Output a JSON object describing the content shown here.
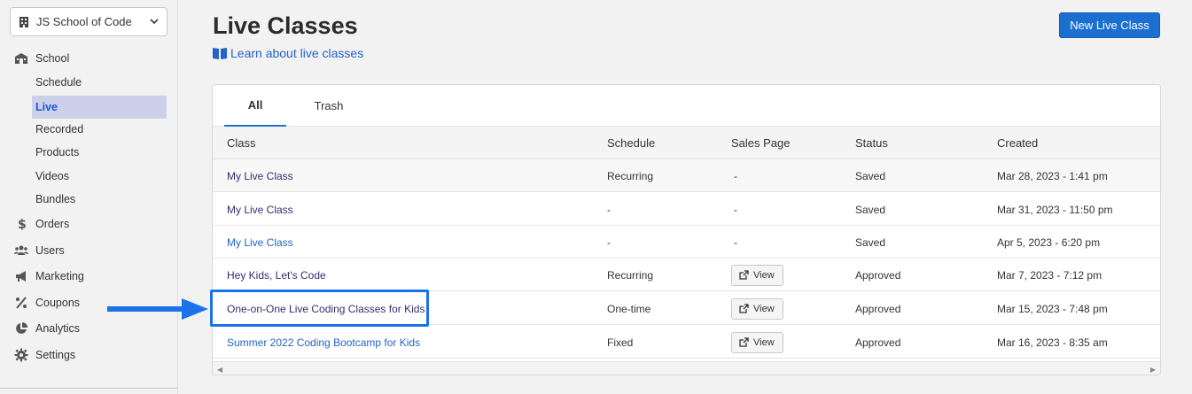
{
  "sidebar": {
    "school_name": "JS School of Code",
    "items": [
      {
        "label": "School",
        "icon": "school-icon"
      },
      {
        "label": "Orders",
        "icon": "dollar-icon"
      },
      {
        "label": "Users",
        "icon": "users-icon"
      },
      {
        "label": "Marketing",
        "icon": "megaphone-icon"
      },
      {
        "label": "Coupons",
        "icon": "percent-icon"
      },
      {
        "label": "Analytics",
        "icon": "pie-chart-icon"
      },
      {
        "label": "Settings",
        "icon": "gear-icon"
      }
    ],
    "sub_items": [
      "Schedule",
      "Live",
      "Recorded",
      "Products",
      "Videos",
      "Bundles"
    ],
    "active_sub_item": "Live"
  },
  "header": {
    "title": "Live Classes",
    "learn_link": "Learn about live classes",
    "new_button": "New Live Class"
  },
  "tabs": [
    "All",
    "Trash"
  ],
  "active_tab": "All",
  "table": {
    "columns": [
      "Class",
      "Schedule",
      "Sales Page",
      "Status",
      "Created"
    ],
    "rows": [
      {
        "class": "My Live Class",
        "schedule": "Recurring",
        "sales_page": "-",
        "status": "Saved",
        "created": "Mar 28, 2023 - 1:41 pm"
      },
      {
        "class": "My Live Class",
        "schedule": "-",
        "sales_page": "-",
        "status": "Saved",
        "created": "Mar 31, 2023 - 11:50 pm"
      },
      {
        "class": "My Live Class",
        "schedule": "-",
        "sales_page": "-",
        "status": "Saved",
        "created": "Apr 5, 2023 - 6:20 pm"
      },
      {
        "class": "Hey Kids, Let's Code",
        "schedule": "Recurring",
        "sales_page": "View",
        "status": "Approved",
        "created": "Mar 7, 2023 - 7:12 pm"
      },
      {
        "class": "One-on-One Live Coding Classes for Kids",
        "schedule": "One-time",
        "sales_page": "View",
        "status": "Approved",
        "created": "Mar 15, 2023 - 7:48 pm"
      },
      {
        "class": "Summer 2022 Coding Bootcamp for Kids",
        "schedule": "Fixed",
        "sales_page": "View",
        "status": "Approved",
        "created": "Mar 16, 2023 - 8:35 am"
      }
    ]
  },
  "colors": {
    "accent": "#1a6fd1",
    "link": "#2563c9",
    "active_nav_bg": "#cdd0ea",
    "callout": "#1a73e8"
  }
}
